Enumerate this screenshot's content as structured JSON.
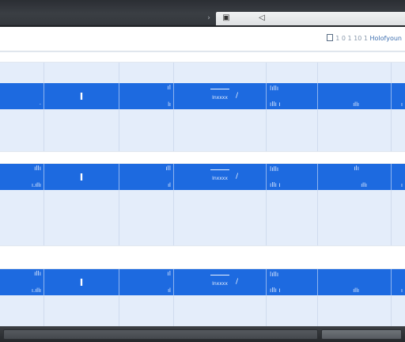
{
  "titlebar": {
    "chevron_glyph": "›",
    "doc_glyph": "▣",
    "flag_glyph": "◁"
  },
  "header": {
    "prefix": "1 0 1 10 1",
    "text": "Holofyoun"
  },
  "rows": [
    {
      "cells": [
        {
          "top": "",
          "mid": "",
          "bot": "·"
        },
        {
          "mid": "I"
        },
        {
          "top": "ıl",
          "bot": "lı"
        },
        {
          "label": "Inxxxx",
          "icon": "/"
        },
        {
          "top": "lıllı",
          "bot": "ıllı ı"
        },
        {
          "top": "",
          "bot": "ıllı"
        },
        {
          "top": "",
          "bot": "ı"
        }
      ]
    },
    {
      "cells": [
        {
          "top": "ıllı",
          "mid": "",
          "bot": "ı.ıllı"
        },
        {
          "mid": "I"
        },
        {
          "top": "ıll",
          "bot": "ıl"
        },
        {
          "label": "Inxxxx",
          "icon": "/"
        },
        {
          "top": "lıllı",
          "bot": "ıllı ı"
        },
        {
          "top": "ılı",
          "bot": "ıllı"
        },
        {
          "top": "",
          "bot": "ı"
        }
      ]
    },
    {
      "cells": [
        {
          "top": "ıllı",
          "mid": "",
          "bot": "ı.ıllı"
        },
        {
          "mid": "I"
        },
        {
          "top": "ıl",
          "bot": "ıl"
        },
        {
          "label": "Inxxxx",
          "icon": "/"
        },
        {
          "top": "lıllı",
          "bot": "ıllı ı"
        },
        {
          "top": "",
          "bot": "ıllı"
        },
        {
          "top": "",
          "bot": "ı"
        }
      ]
    }
  ],
  "colors": {
    "row_blue": "#1d6ae0",
    "section_bg": "#e4edfa",
    "titlebar_dark": "#2b2e33"
  }
}
